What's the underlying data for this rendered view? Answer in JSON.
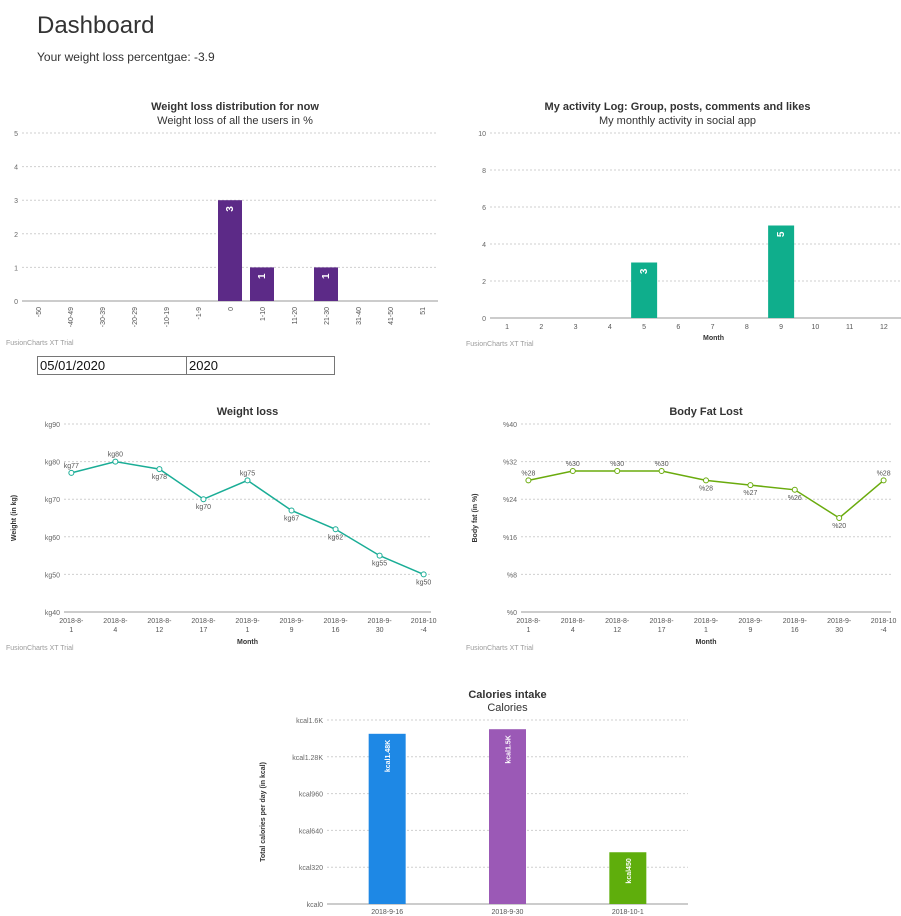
{
  "page": {
    "title": "Dashboard",
    "weight_loss_line": "Your weight loss percentgae: -3.9",
    "watermark": "FusionCharts XT Trial",
    "inputs": {
      "date_value": "05/01/2020",
      "year_value": "2020"
    }
  },
  "chart_data": [
    {
      "id": "distribution",
      "type": "bar",
      "title": "Weight loss distribution for now",
      "subtitle": "Weight loss of all the users in %",
      "xlabel": "",
      "ylabel": "",
      "ylim": [
        0,
        5
      ],
      "yticks": [
        0,
        1,
        2,
        3,
        4,
        5
      ],
      "ytick_labels": [
        "0",
        "1",
        "2",
        "3",
        "4",
        "5"
      ],
      "categories": [
        "-50",
        "-40-49",
        "-30-39",
        "-20-29",
        "-10-19",
        "-1-9",
        "0",
        "1-10",
        "11-20",
        "21-30",
        "31-40",
        "41-50",
        "51"
      ],
      "values": [
        0,
        0,
        0,
        0,
        0,
        0,
        3,
        1,
        0,
        1,
        0,
        0,
        0
      ],
      "value_labels": [
        "",
        "",
        "",
        "",
        "",
        "",
        "3",
        "1",
        "",
        "1",
        "",
        "",
        ""
      ],
      "color": "#5c2a87",
      "grid": true
    },
    {
      "id": "activity",
      "type": "bar",
      "title": "My activity Log: Group, posts, comments and likes",
      "subtitle": "My monthly activity in social app",
      "xlabel": "Month",
      "ylabel": "",
      "ylim": [
        0,
        10
      ],
      "yticks": [
        0,
        2,
        4,
        6,
        8,
        10
      ],
      "ytick_labels": [
        "0",
        "2",
        "4",
        "6",
        "8",
        "10"
      ],
      "categories": [
        "1",
        "2",
        "3",
        "4",
        "5",
        "6",
        "7",
        "8",
        "9",
        "10",
        "11",
        "12"
      ],
      "values": [
        0,
        0,
        0,
        0,
        3,
        0,
        0,
        0,
        5,
        0,
        0,
        0
      ],
      "value_labels": [
        "",
        "",
        "",
        "",
        "3",
        "",
        "",
        "",
        "5",
        "",
        "",
        ""
      ],
      "color": "#0fae8c",
      "grid": true
    },
    {
      "id": "weight",
      "type": "line",
      "title": "Weight loss",
      "subtitle": "",
      "xlabel": "Month",
      "ylabel": "Weight (in kg)",
      "ylim": [
        40,
        90
      ],
      "yticks": [
        40,
        50,
        60,
        70,
        80,
        90
      ],
      "ytick_labels": [
        "kg40",
        "kg50",
        "kg60",
        "kg70",
        "kg80",
        "kg90"
      ],
      "categories": [
        "2018-8-1",
        "2018-8-4",
        "2018-8-12",
        "2018-8-17",
        "2018-9-1",
        "2018-9-9",
        "2018-9-16",
        "2018-9-30",
        "2018-10-4"
      ],
      "category_lines": [
        [
          "2018-8-",
          "1"
        ],
        [
          "2018-8-",
          "4"
        ],
        [
          "2018-8-",
          "12"
        ],
        [
          "2018-8-",
          "17"
        ],
        [
          "2018-9-",
          "1"
        ],
        [
          "2018-9-",
          "9"
        ],
        [
          "2018-9-",
          "16"
        ],
        [
          "2018-9-",
          "30"
        ],
        [
          "2018-10",
          "-4"
        ]
      ],
      "values": [
        77,
        80,
        78,
        70,
        75,
        67,
        62,
        55,
        50
      ],
      "value_labels": [
        "kg77",
        "kg80",
        "kg78",
        "kg70",
        "kg75",
        "kg67",
        "kg62",
        "kg55",
        "kg50"
      ],
      "label_side": [
        "above",
        "above",
        "below",
        "below",
        "above",
        "below",
        "below",
        "below",
        "below"
      ],
      "color": "#1aad96",
      "grid": true
    },
    {
      "id": "bodyfat",
      "type": "line",
      "title": "Body Fat Lost",
      "subtitle": "",
      "xlabel": "Month",
      "ylabel": "Body fat (in %)",
      "ylim": [
        0,
        40
      ],
      "yticks": [
        0,
        8,
        16,
        24,
        32,
        40
      ],
      "ytick_labels": [
        "%0",
        "%8",
        "%16",
        "%24",
        "%32",
        "%40"
      ],
      "categories": [
        "2018-8-1",
        "2018-8-4",
        "2018-8-12",
        "2018-8-17",
        "2018-9-1",
        "2018-9-9",
        "2018-9-16",
        "2018-9-30",
        "2018-10-4"
      ],
      "category_lines": [
        [
          "2018-8-",
          "1"
        ],
        [
          "2018-8-",
          "4"
        ],
        [
          "2018-8-",
          "12"
        ],
        [
          "2018-8-",
          "17"
        ],
        [
          "2018-9-",
          "1"
        ],
        [
          "2018-9-",
          "9"
        ],
        [
          "2018-9-",
          "16"
        ],
        [
          "2018-9-",
          "30"
        ],
        [
          "2018-10",
          "-4"
        ]
      ],
      "values": [
        28,
        30,
        30,
        30,
        28,
        27,
        26,
        20,
        28
      ],
      "value_labels": [
        "%28",
        "%30",
        "%30",
        "%30",
        "%28",
        "%27",
        "%26",
        "%20",
        "%28"
      ],
      "label_side": [
        "above",
        "above",
        "above",
        "above",
        "below",
        "below",
        "below",
        "below",
        "above"
      ],
      "color": "#6aab0d",
      "grid": true
    },
    {
      "id": "calories",
      "type": "bar",
      "title": "Calories intake",
      "subtitle": "Calories",
      "xlabel": "",
      "ylabel": "Total calories per day (in kcal)",
      "ylim": [
        0,
        1600
      ],
      "yticks": [
        0,
        320,
        640,
        960,
        1280,
        1600
      ],
      "ytick_labels": [
        "kcal0",
        "kcal320",
        "kcal640",
        "kcal960",
        "kcal1.28K",
        "kcal1.6K"
      ],
      "categories": [
        "2018-9-16",
        "2018-9-30",
        "2018-10-1"
      ],
      "values": [
        1480,
        1520,
        450
      ],
      "value_labels": [
        "kcal1.48K",
        "kcal1.5K",
        "kcal450"
      ],
      "colors": [
        "#1e88e5",
        "#9b59b6",
        "#5fae0c"
      ],
      "grid": true
    }
  ]
}
